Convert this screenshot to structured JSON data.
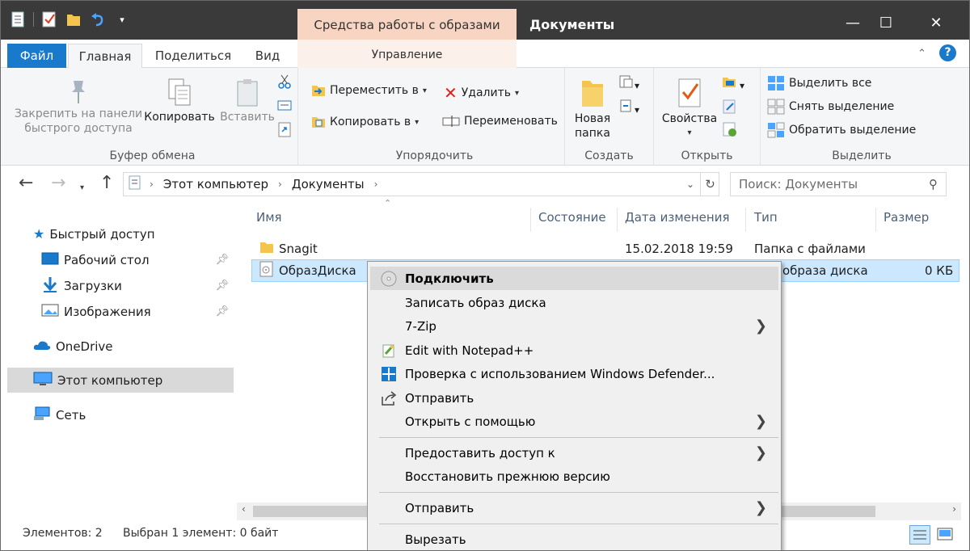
{
  "window": {
    "contextual_tab_title": "Средства работы с образами диска",
    "title": "Документы",
    "minimize": "—",
    "maximize": "☐",
    "close": "✕"
  },
  "ribbon_tabs": {
    "file": "Файл",
    "home": "Главная",
    "share": "Поделиться",
    "view": "Вид",
    "manage": "Управление"
  },
  "ribbon": {
    "clipboard": {
      "pin": "Закрепить на панели быстрого доступа",
      "pin_line1": "Закрепить на панели",
      "pin_line2": "быстрого доступа",
      "copy": "Копировать",
      "paste": "Вставить",
      "label": "Буфер обмена"
    },
    "organize": {
      "move_to": "Переместить в",
      "copy_to": "Копировать в",
      "delete": "Удалить",
      "rename": "Переименовать",
      "label": "Упорядочить"
    },
    "new": {
      "new_folder_line1": "Новая",
      "new_folder_line2": "папка",
      "label": "Создать"
    },
    "open": {
      "properties": "Свойства",
      "label": "Открыть"
    },
    "select": {
      "select_all": "Выделить все",
      "select_none": "Снять выделение",
      "invert": "Обратить выделение",
      "label": "Выделить"
    }
  },
  "address": {
    "crumb1": "Этот компьютер",
    "crumb2": "Документы",
    "search_placeholder": "Поиск: Документы"
  },
  "nav": {
    "quick_access": "Быстрый доступ",
    "desktop": "Рабочий стол",
    "downloads": "Загрузки",
    "pictures": "Изображения",
    "onedrive": "OneDrive",
    "this_pc": "Этот компьютер",
    "network": "Сеть"
  },
  "columns": {
    "name": "Имя",
    "status": "Состояние",
    "date": "Дата изменения",
    "type": "Тип",
    "size": "Размер"
  },
  "files": [
    {
      "name": "Snagit",
      "date": "15.02.2018 19:59",
      "type": "Папка с файлами",
      "size": ""
    },
    {
      "name": "ОбразДиска",
      "date": "",
      "type": "а образа диска",
      "size": "0 КБ"
    }
  ],
  "status": {
    "count": "Элементов: 2",
    "selected": "Выбран 1 элемент: 0 байт"
  },
  "context_menu": {
    "mount": "Подключить",
    "burn": "Записать образ диска",
    "sevenzip": "7-Zip",
    "notepad": "Edit with Notepad++",
    "defender": "Проверка с использованием Windows Defender...",
    "share": "Отправить",
    "open_with": "Открыть с помощью",
    "give_access": "Предоставить доступ к",
    "restore": "Восстановить прежнюю версию",
    "send_to": "Отправить",
    "cut": "Вырезать"
  },
  "colors": {
    "titlebar": "#3a3a3a",
    "file_tab": "#1979ca",
    "contextual_tab": "#f8d5c3",
    "selection": "#cce8ff",
    "menu_bg": "#f0f0f0"
  }
}
